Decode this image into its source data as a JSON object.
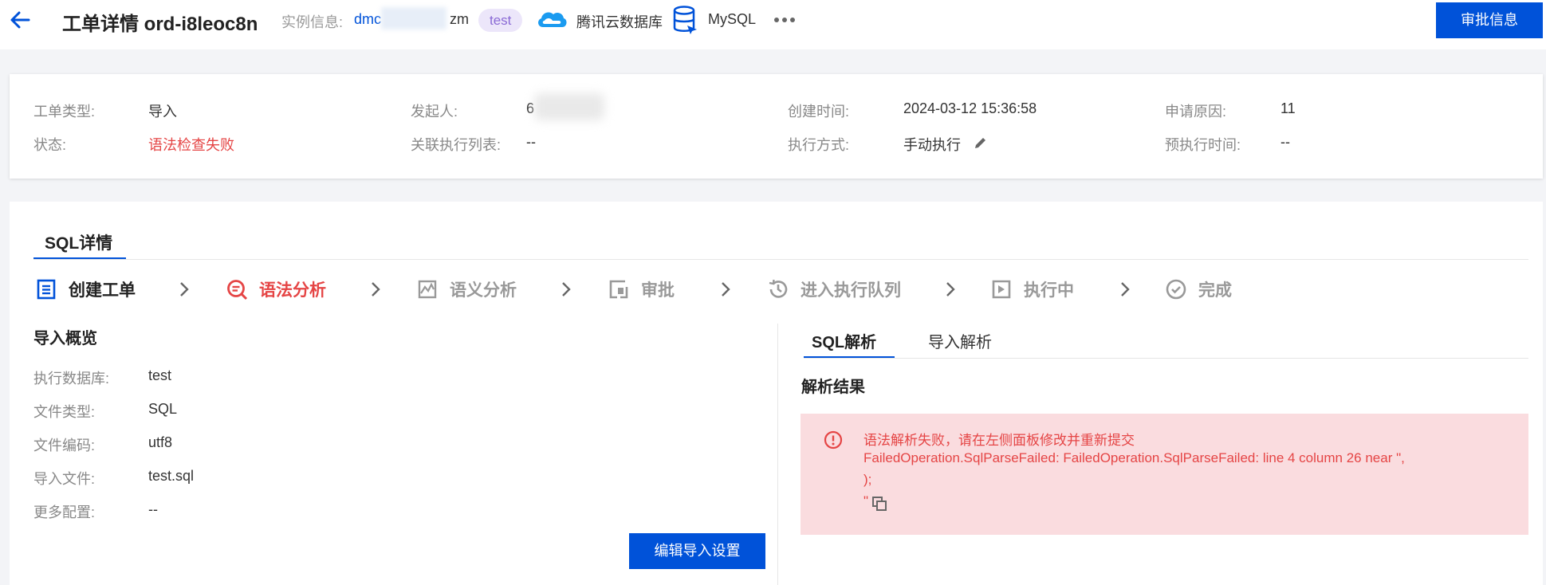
{
  "header": {
    "title": "工单详情 ord-i8leoc8n",
    "instance_label": "实例信息:",
    "instance_id_prefix": "dmc",
    "instance_id_suffix": "zm",
    "instance_tag": "test",
    "cloud_db": "腾讯云数据库",
    "db_type": "MySQL",
    "approve_button": "审批信息"
  },
  "info": {
    "type_label": "工单类型:",
    "type_value": "导入",
    "status_label": "状态:",
    "status_value": "语法检查失败",
    "initiator_label": "发起人:",
    "initiator_value": "6",
    "related_label": "关联执行列表:",
    "related_value": "--",
    "created_label": "创建时间:",
    "created_value": "2024-03-12 15:36:58",
    "exec_mode_label": "执行方式:",
    "exec_mode_value": "手动执行",
    "reason_label": "申请原因:",
    "reason_value": "11",
    "pre_exec_label": "预执行时间:",
    "pre_exec_value": "--"
  },
  "tabs": {
    "sql_detail": "SQL详情"
  },
  "steps": [
    {
      "label": "创建工单",
      "state": "done"
    },
    {
      "label": "语法分析",
      "state": "error"
    },
    {
      "label": "语义分析",
      "state": "pending"
    },
    {
      "label": "审批",
      "state": "pending"
    },
    {
      "label": "进入执行队列",
      "state": "pending"
    },
    {
      "label": "执行中",
      "state": "pending"
    },
    {
      "label": "完成",
      "state": "pending"
    }
  ],
  "overview": {
    "title": "导入概览",
    "rows": [
      {
        "label": "执行数据库:",
        "value": "test"
      },
      {
        "label": "文件类型:",
        "value": "SQL"
      },
      {
        "label": "文件编码:",
        "value": "utf8"
      },
      {
        "label": "导入文件:",
        "value": "test.sql"
      },
      {
        "label": "更多配置:",
        "value": "--"
      }
    ],
    "edit_button": "编辑导入设置"
  },
  "right_tabs": [
    "SQL解析",
    "导入解析"
  ],
  "result": {
    "title": "解析结果",
    "message": "语法解析失败，请在左侧面板修改并重新提交",
    "error_line1": "FailedOperation.SqlParseFailed: FailedOperation.SqlParseFailed: line 4 column 26 near \",",
    "error_line2": ");",
    "error_line3": "\""
  },
  "colors": {
    "primary": "#0052d9",
    "error": "#e54545",
    "error_bg": "#fadcdf",
    "tag_bg": "#ece6fa",
    "tag_text": "#8b6bd6"
  }
}
